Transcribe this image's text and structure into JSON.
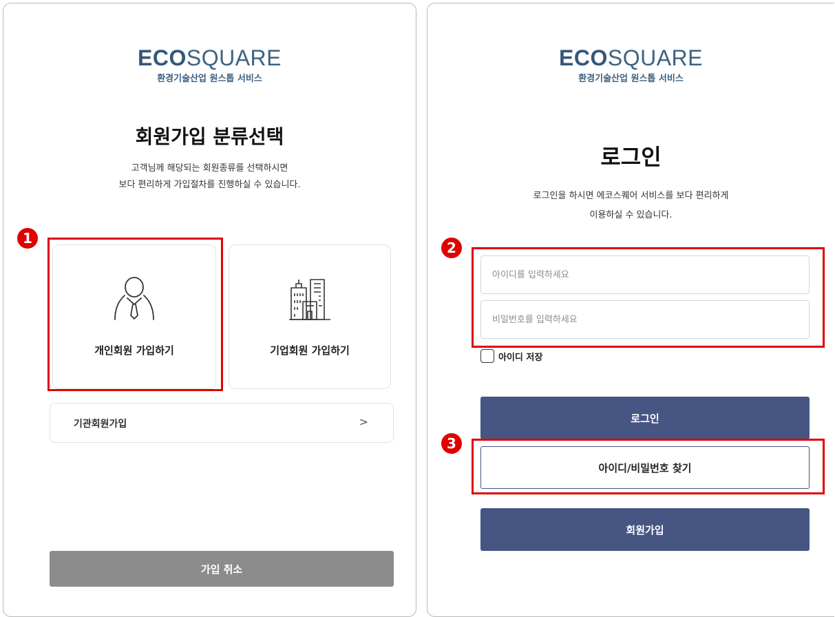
{
  "brand": {
    "logo_bold": "ECO",
    "logo_light": "SQUARE",
    "tagline": "환경기술산업 원스톱 서비스",
    "color_primary": "#34577a"
  },
  "signup": {
    "title": "회원가입 분류선택",
    "desc_line1": "고객님께 해당되는 회원종류를 선택하시면",
    "desc_line2": "보다 편리하게 가입절차를 진행하실 수 있습니다.",
    "badge": "1",
    "personal_label": "개인회원 가입하기",
    "personal_icon": "person-icon",
    "corporate_label": "기업회원 가입하기",
    "corporate_icon": "building-icon",
    "org_label": "기관회원가입",
    "org_chevron": ">",
    "cancel_label": "가입 취소"
  },
  "login": {
    "title": "로그인",
    "desc_line1": "로그인을 하시면 에코스퀘어 서비스를 보다 편리하게",
    "desc_line2": "이용하실 수 있습니다.",
    "badge_fields": "2",
    "id_placeholder": "아이디를 입력하세요",
    "pw_placeholder": "비밀번호를 입력하세요",
    "save_id_label": "아이디 저장",
    "login_button": "로그인",
    "badge_find": "3",
    "find_button": "아이디/비밀번호 찾기",
    "join_button": "회원가입",
    "color_button": "#465582"
  },
  "highlight_color": "#e00000"
}
